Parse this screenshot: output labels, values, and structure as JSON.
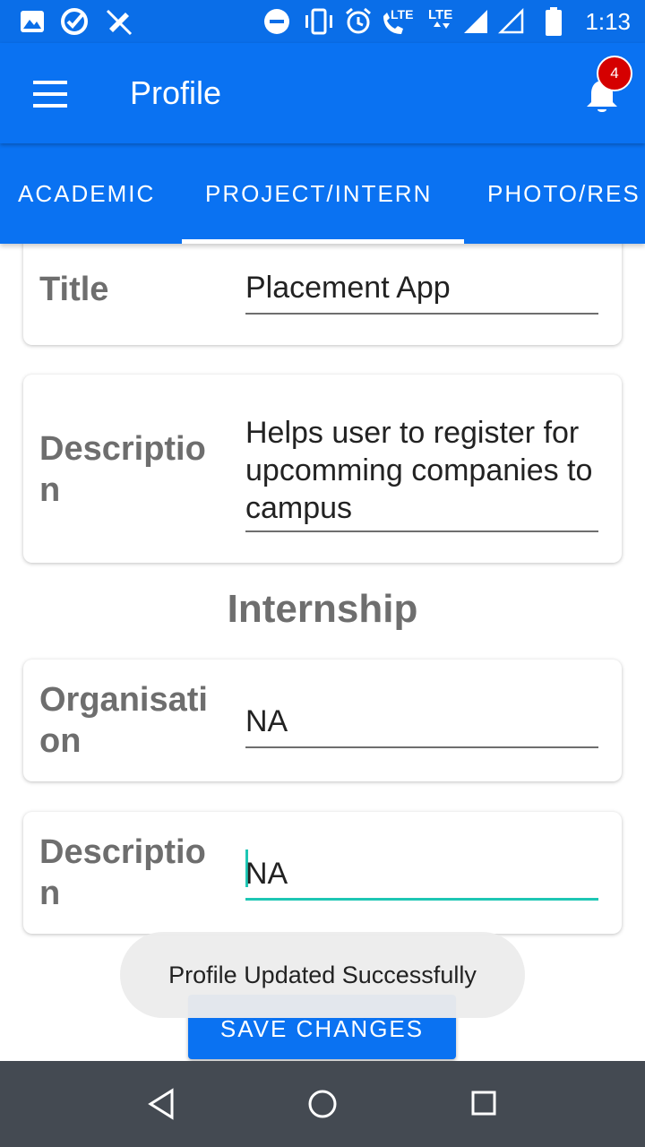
{
  "status_bar": {
    "time": "1:13",
    "network_labels": [
      "LTE",
      "LTE"
    ],
    "left_icons": [
      "image-icon",
      "check-badge-icon",
      "call-off-icon"
    ],
    "right_icons": [
      "do-not-disturb-icon",
      "vibrate-icon",
      "alarm-icon",
      "lte-call-icon",
      "lte-data-icon",
      "signal-full-icon",
      "signal-empty-icon",
      "battery-icon"
    ]
  },
  "app_bar": {
    "title": "Profile",
    "menu_icon": "menu-icon",
    "notification_icon": "bell-icon",
    "notification_count": "4"
  },
  "tabs": [
    {
      "label": "ACADEMIC",
      "selected": false
    },
    {
      "label": "PROJECT/INTERN",
      "selected": true
    },
    {
      "label": "PHOTO/RES",
      "selected": false
    }
  ],
  "project": {
    "title_label": "Title",
    "title_value": "Placement App",
    "description_label": "Descriptio n",
    "description_value": "Helps user to register for upcomming companies to campus"
  },
  "internship": {
    "heading": "Internship",
    "organisation_label": "Organisati on",
    "organisation_value": "NA",
    "description_label": "Descriptio n",
    "description_value": "NA"
  },
  "save_button": "SAVE CHANGES",
  "toast": "Profile Updated Successfully",
  "nav_bar": {
    "icons": [
      "back-icon",
      "home-icon",
      "recents-icon"
    ]
  },
  "colors": {
    "primary": "#0a72f2",
    "focus_underline": "#1ec6b4",
    "badge": "#d50000",
    "nav_bar": "#444a52"
  }
}
